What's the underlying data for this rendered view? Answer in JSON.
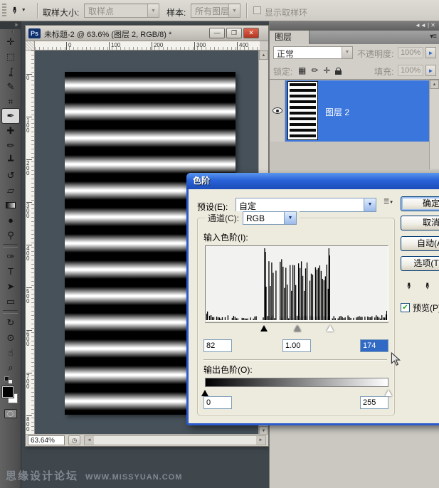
{
  "options_bar": {
    "tool_icon": "eyedropper-icon",
    "sample_size_label": "取样大小:",
    "sample_size_value": "取样点",
    "sample_label": "样本:",
    "sample_value": "所有图层",
    "show_ring_label": "显示取样环"
  },
  "icons": {
    "dropdown": "▼",
    "caret": "▼",
    "collapse": "◄◄ | ✕",
    "panel_menu": "▾≡",
    "minimize": "—",
    "maximize": "❐",
    "close": "✕",
    "scroll_up": "▲",
    "scroll_down": "▼",
    "scroll_left": "◄",
    "scroll_right": "►",
    "eyedropper": "✒",
    "clock": "◷",
    "collapse_tools": "»",
    "lock_checker": "▦",
    "lock_brush": "✏",
    "lock_move": "✛",
    "preset_menu_lines": "☰",
    "check": "✔",
    "quick_mask": "◯"
  },
  "tools": [
    {
      "name": "move-tool",
      "glyph": "✛"
    },
    {
      "name": "rectangular-marquee-tool",
      "glyph": "⬚"
    },
    {
      "name": "lasso-tool",
      "glyph": "ʆ"
    },
    {
      "name": "quick-selection-tool",
      "glyph": "✎"
    },
    {
      "name": "crop-tool",
      "glyph": "⌗"
    },
    {
      "name": "eyedropper-tool",
      "glyph": "✒",
      "active": true
    },
    {
      "name": "healing-brush-tool",
      "glyph": "✚"
    },
    {
      "name": "brush-tool",
      "glyph": "✏"
    },
    {
      "name": "clone-stamp-tool",
      "glyph": "┻"
    },
    {
      "name": "history-brush-tool",
      "glyph": "↺"
    },
    {
      "name": "eraser-tool",
      "glyph": "▱"
    },
    {
      "name": "gradient-tool",
      "glyph": "",
      "css": "gradient"
    },
    {
      "name": "blur-tool",
      "glyph": "●"
    },
    {
      "name": "dodge-tool",
      "glyph": "⚲",
      "sep_after": true
    },
    {
      "name": "pen-tool",
      "glyph": "✑"
    },
    {
      "name": "type-tool",
      "glyph": "T"
    },
    {
      "name": "path-selection-tool",
      "glyph": "➤"
    },
    {
      "name": "rectangle-tool",
      "glyph": "▭",
      "sep_after": true
    },
    {
      "name": "3d-rotate-tool",
      "glyph": "↻"
    },
    {
      "name": "3d-orbit-tool",
      "glyph": "⊙"
    },
    {
      "name": "hand-tool",
      "glyph": "☝"
    },
    {
      "name": "zoom-tool",
      "glyph": "⌕"
    }
  ],
  "document_window": {
    "title": "未标题-2 @ 63.6% (图层 2, RGB/8) *",
    "ps_badge": "Ps",
    "zoom_value": "63.64%",
    "ruler_h_ticks": [
      "0",
      "100",
      "200",
      "300",
      "400"
    ],
    "ruler_v_ticks": [
      "0",
      "100",
      "200",
      "300",
      "400",
      "500",
      "600",
      "700",
      "800"
    ]
  },
  "layers_panel": {
    "tab_label": "图层",
    "blend_mode_value": "正常",
    "opacity_label": "不透明度:",
    "opacity_value": "100%",
    "lock_label": "锁定:",
    "fill_label": "填充:",
    "fill_value": "100%",
    "layer_name": "图层 2"
  },
  "levels_dialog": {
    "title": "色阶",
    "preset_label": "预设(E):",
    "preset_value": "自定",
    "channel_label": "通道(C):",
    "channel_value": "RGB",
    "input_label": "输入色阶(I):",
    "input_shadow": "82",
    "input_gamma": "1.00",
    "input_highlight": "174",
    "output_label": "输出色阶(O):",
    "output_shadow": "0",
    "output_highlight": "255",
    "histogram": {
      "cluster_start": 82,
      "cluster_end": 174,
      "scale_max": 255
    },
    "buttons": {
      "ok": "确定",
      "cancel": "取消",
      "auto": "自动(A)",
      "options": "选项(T)...",
      "preview": "预览(P)"
    }
  },
  "watermark": {
    "text_cn": "思缘设计论坛",
    "text_en": "WWW.MISSYUAN.COM"
  },
  "colors": {
    "selection_blue": "#3b76dd",
    "dialog_border_blue": "#2b5bcd",
    "text_selection_blue": "#316ac5",
    "canvas_background": "#46515a",
    "chrome_gray": "#d5d2cb"
  }
}
